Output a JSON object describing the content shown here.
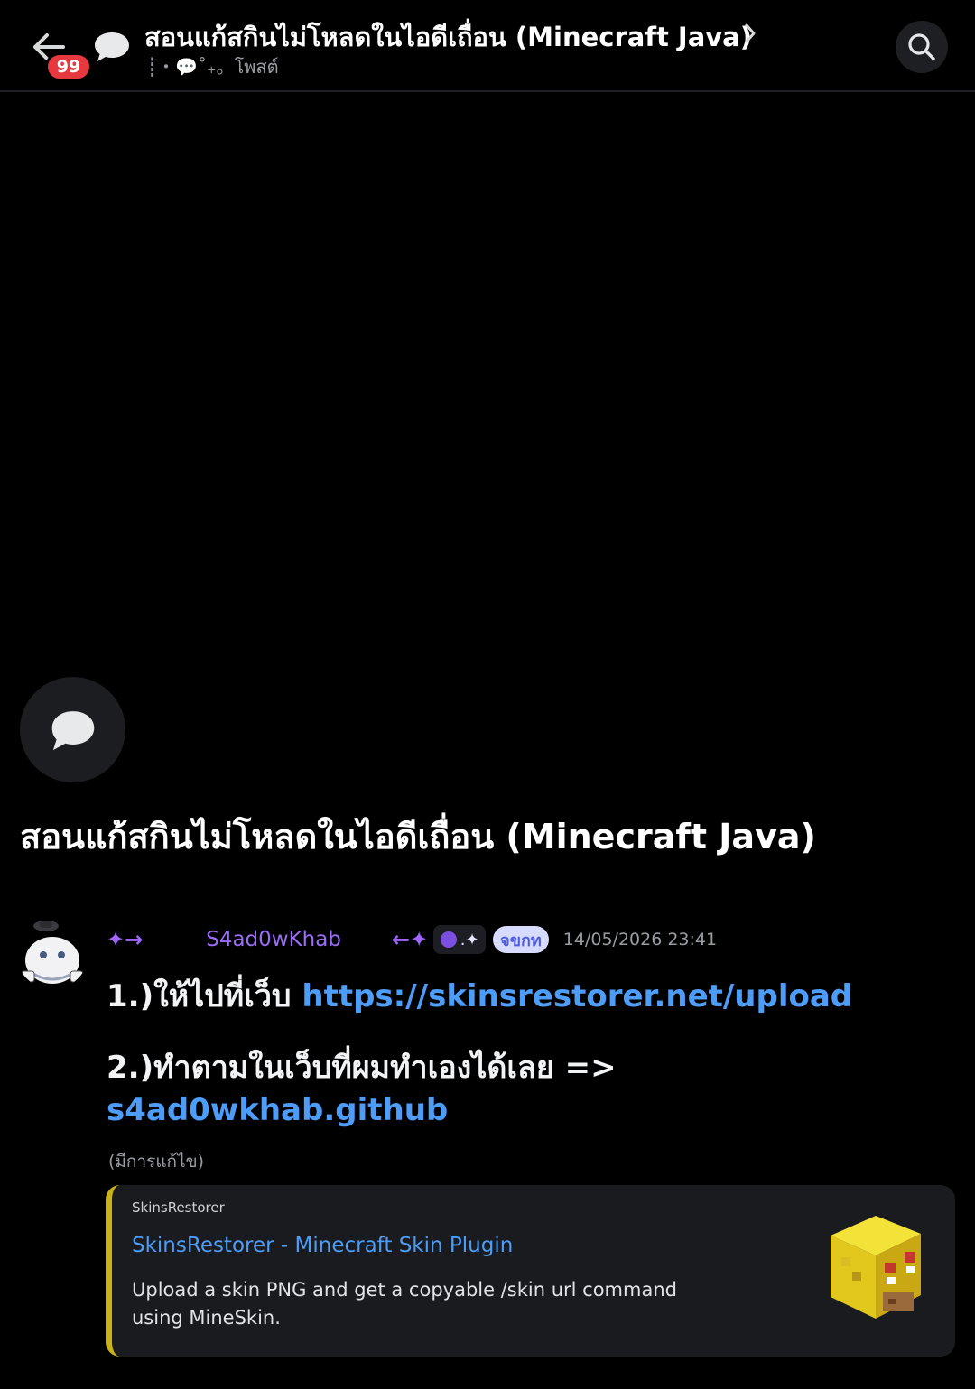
{
  "header": {
    "title": "สอนแก้สกินไม่โหลดในไอดีเถื่อน (Minecraft Java)",
    "badge_count": "99",
    "channel_label": "┊・💬˚₊。โพสต์"
  },
  "thread": {
    "title": "สอนแก้สกินไม่โหลดในไอดีเถื่อน (Minecraft Java)"
  },
  "message": {
    "prefix_deco": "✦→",
    "username": "S4ad0wKhab",
    "suffix_deco": "←✦",
    "role_icon_text": ".✦",
    "tag": "จขกท",
    "timestamp": "14/05/2026 23:41",
    "line1_text": "1.)ให้ไปที่เว็บ ",
    "line1_link": "https://skinsrestorer.net/upload",
    "line2_text": "2.)ทำตามในเว็บที่ผมทำเองได้เลย =>",
    "line3_link": "s4ad0wkhab.github",
    "edited": "(มีการแก้ไข)"
  },
  "embed": {
    "provider": "SkinsRestorer",
    "title": "SkinsRestorer - Minecraft Skin Plugin",
    "description": "Upload a skin PNG and get a copyable /skin url command using MineSkin.",
    "accent_color": "#c9b21a"
  },
  "icons": {
    "back": "arrow-left-icon",
    "thread": "chat-bubble-icon",
    "search": "search-icon",
    "chevron": "chevron-right-icon"
  }
}
